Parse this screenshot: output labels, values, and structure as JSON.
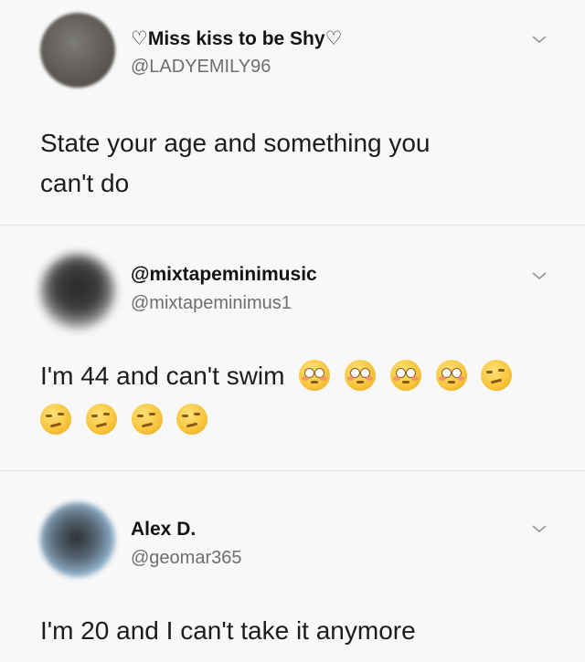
{
  "tweets": [
    {
      "name": "♡Miss kiss to be Shy♡",
      "handle": "@LADYEMILY96",
      "text_line1": "State your age and something you",
      "text_line2": "can't do"
    },
    {
      "name": "@mixtapeminimusic",
      "handle": "@mixtapeminimus1",
      "text_line1": "I'm 44 and can't swim",
      "emoji_line1": [
        "flushed-face",
        "flushed-face",
        "flushed-face",
        "flushed-face",
        "wry-face"
      ],
      "emoji_line2": [
        "wry-face",
        "wry-face",
        "wry-face",
        "wry-face"
      ]
    },
    {
      "name": "Alex D.",
      "handle": "@geomar365",
      "text_line1": "I'm 20 and I can't take it anymore"
    }
  ],
  "icons": {
    "menu": "chevron-down-icon"
  },
  "colors": {
    "background": "#f8f8f8",
    "name": "#141414",
    "handle": "#6e6e6e",
    "divider": "#e3e3e3"
  }
}
